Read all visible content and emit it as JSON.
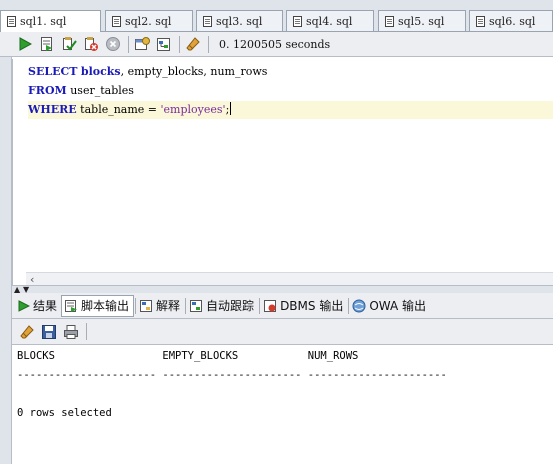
{
  "editor_tabs": [
    {
      "label": "sql1. sql",
      "active": true
    },
    {
      "label": "sql2. sql",
      "active": false
    },
    {
      "label": "sql3. sql",
      "active": false
    },
    {
      "label": "sql4. sql",
      "active": false
    },
    {
      "label": "sql5. sql",
      "active": false
    },
    {
      "label": "sql6. sql",
      "active": false
    }
  ],
  "toolbar": {
    "execution_time": "0. 1200505 seconds",
    "icons": [
      "run-statement-icon",
      "run-script-icon",
      "commit-icon",
      "rollback-icon",
      "cancel-icon",
      "sql-history-icon",
      "explain-plan-icon",
      "clear-icon"
    ]
  },
  "editor": {
    "line1": {
      "kw": "SELECT",
      "kw2": "blocks",
      "rest": ", empty_blocks, num_rows"
    },
    "line2": {
      "kw": "FROM",
      "rest": " user_tables"
    },
    "line3": {
      "kw": "WHERE",
      "rest": " table_name = ",
      "str": "'employees'",
      "end": ";"
    }
  },
  "output_tabs": [
    {
      "label": "结果",
      "icon": "run-icon",
      "active": false
    },
    {
      "label": "脚本输出",
      "icon": "script-output-icon",
      "active": true
    },
    {
      "label": "解释",
      "icon": "explain-icon",
      "active": false
    },
    {
      "label": "自动跟踪",
      "icon": "autotrace-icon",
      "active": false
    },
    {
      "label": "DBMS 输出",
      "icon": "dbms-output-icon",
      "active": false
    },
    {
      "label": "OWA 输出",
      "icon": "owa-output-icon",
      "active": false
    }
  ],
  "output_toolbar": {
    "icons": [
      "eraser-icon",
      "save-icon",
      "print-icon"
    ]
  },
  "script_output": {
    "header": "BLOCKS                 EMPTY_BLOCKS           NUM_ROWS",
    "separator": "---------------------- ---------------------- ----------------------",
    "blank": "",
    "result": "0 rows selected"
  },
  "colors": {
    "keyword": "#1a1ab8",
    "string": "#7a2a9a",
    "current_line": "#fbf8d9"
  }
}
